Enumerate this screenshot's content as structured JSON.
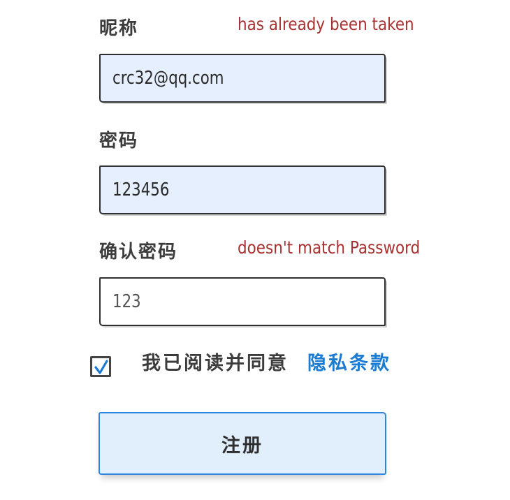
{
  "form": {
    "nickname": {
      "label": "昵称",
      "value": "crc32@qq.com",
      "error": "has already been taken"
    },
    "password": {
      "label": "密码",
      "value": "123456",
      "error": ""
    },
    "confirm_password": {
      "label": "确认密码",
      "value": "123",
      "error": "doesn't match Password"
    },
    "agreement": {
      "checked": true,
      "text": "我已阅读并同意",
      "link_text": "隐私条款"
    },
    "submit_label": "注册"
  },
  "colors": {
    "error": "#a83232",
    "link": "#1b7bd0",
    "field_fill": "#e6effd",
    "button_border": "#2f86de",
    "button_fill": "#e1eefc",
    "checkmark": "#1b7bd0"
  },
  "icons": {
    "checkbox": "checkmark-icon"
  }
}
